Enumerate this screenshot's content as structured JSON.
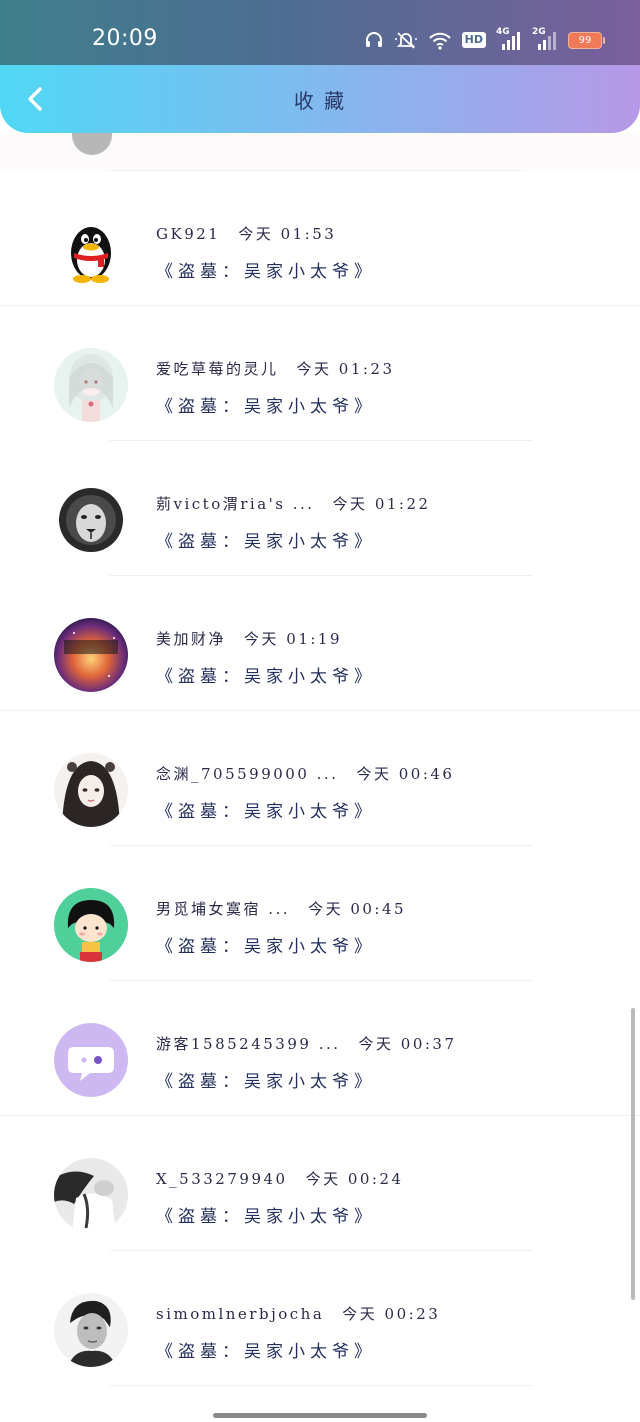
{
  "status_bar": {
    "time": "20:09",
    "network": "HD",
    "net_4g": "4G",
    "net_2g": "2G",
    "battery": "99"
  },
  "header": {
    "title": "收 藏"
  },
  "favorites": [
    {
      "name": "GK921",
      "time": "今天 01:53",
      "content": "《盗墓：吴家小太爷》",
      "avatar": "qq-penguin-icon"
    },
    {
      "name": "爱吃草莓的灵儿",
      "time": "今天 01:23",
      "content": "《盗墓：吴家小太爷》",
      "avatar": "anime-girl-avatar"
    },
    {
      "name": "莂victo渭ria's ...",
      "time": "今天 01:22",
      "content": "《盗墓：吴家小太爷》",
      "avatar": "lion-avatar"
    },
    {
      "name": "美加财净",
      "time": "今天 01:19",
      "content": "《盗墓：吴家小太爷》",
      "avatar": "galaxy-avatar"
    },
    {
      "name": "念渊_705599000 ...",
      "time": "今天 00:46",
      "content": "《盗墓：吴家小太爷》",
      "avatar": "ink-girl-avatar"
    },
    {
      "name": "男觅埔女寞宿 ...",
      "time": "今天 00:45",
      "content": "《盗墓：吴家小太爷》",
      "avatar": "cartoon-girl-avatar"
    },
    {
      "name": "游客1585245399 ...",
      "time": "今天 00:37",
      "content": "《盗墓：吴家小太爷》",
      "avatar": "chat-bubble-icon"
    },
    {
      "name": "X_533279940",
      "time": "今天 00:24",
      "content": "《盗墓：吴家小太爷》",
      "avatar": "bw-photo-avatar"
    },
    {
      "name": "simomlnerbjocha",
      "time": "今天 00:23",
      "content": "《盗墓：吴家小太爷》",
      "avatar": "man-portrait-avatar"
    }
  ]
}
